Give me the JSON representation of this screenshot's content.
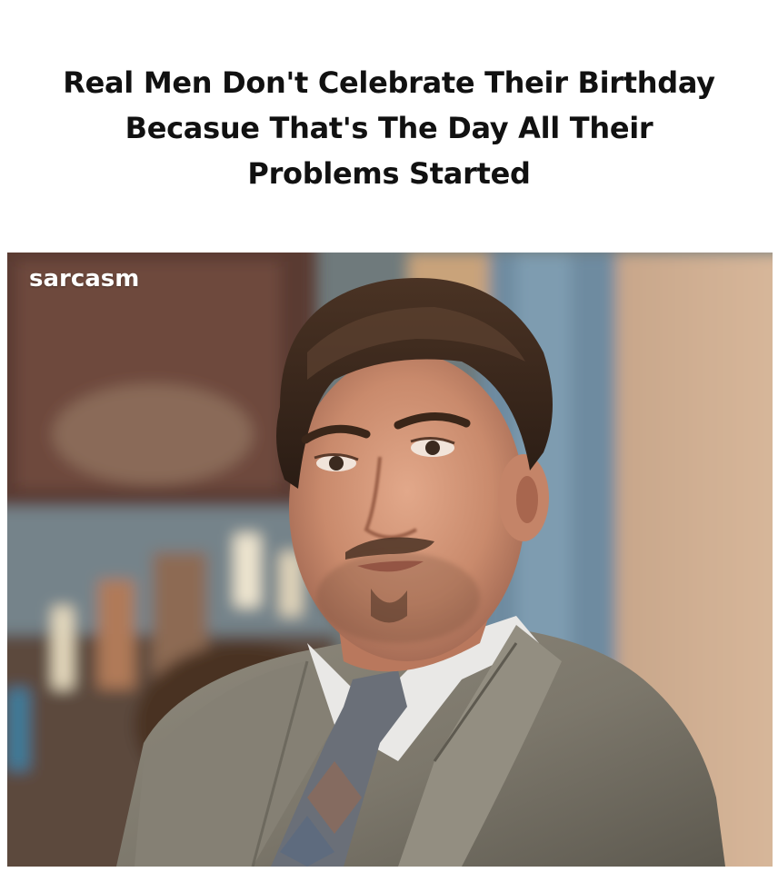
{
  "caption": {
    "lines": [
      "Real Men Don't Celebrate Their Birthday",
      "Becasue That's The Day All Their",
      "Problems Started"
    ]
  },
  "photo": {
    "watermark": "sarcasm",
    "subject": "man-in-grey-suit-icon"
  }
}
